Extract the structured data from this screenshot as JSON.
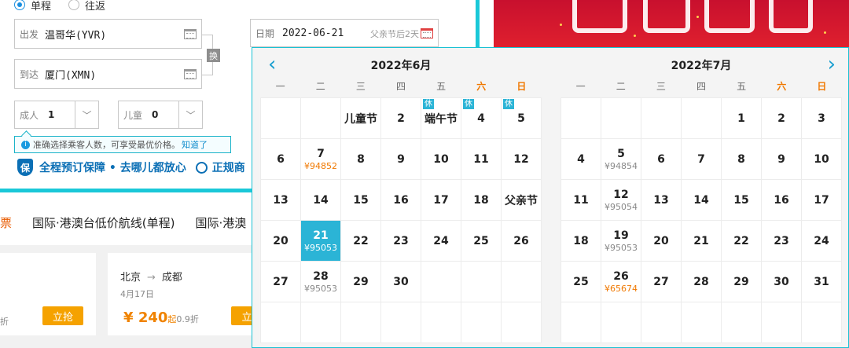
{
  "trip_type": {
    "oneway": "单程",
    "roundtrip": "往返"
  },
  "depart": {
    "label": "出发",
    "value": "温哥华(YVR)"
  },
  "arrive": {
    "label": "到达",
    "value": "厦门(XMN)"
  },
  "swap_label": "换",
  "adult": {
    "label": "成人",
    "value": "1"
  },
  "child": {
    "label": "儿童",
    "value": "0"
  },
  "tip": {
    "text": "准确选择乘客人数，可享受最优价格。",
    "link": "知道了"
  },
  "guarantee": {
    "text": "全程预订保障 • 去哪儿都放心",
    "text2": "正规商"
  },
  "tabs": {
    "first": "票",
    "t1": "国际·港澳台低价航线(单程)",
    "t2": "国际·港澳"
  },
  "card1": {
    "discount": "折",
    "grab": "立抢"
  },
  "card2": {
    "from": "北京",
    "arrow": "→",
    "to": "成都",
    "date": "4月17日",
    "currency": "¥",
    "price": "240",
    "qi": "起",
    "discount": "0.9折",
    "grab": "立"
  },
  "date_field": {
    "label": "日期",
    "value": "2022-06-21",
    "hint": "父亲节后2天"
  },
  "calendar": {
    "prev": "‹",
    "next": "›",
    "weekdays": [
      "一",
      "二",
      "三",
      "四",
      "五",
      "六",
      "日"
    ],
    "months": [
      {
        "title": "2022年6月",
        "offset": 2,
        "days": [
          {
            "d": "儿童节"
          },
          {
            "d": "2"
          },
          {
            "d": "端午节",
            "rest": "休"
          },
          {
            "d": "4",
            "rest": "休"
          },
          {
            "d": "5",
            "rest": "休"
          },
          {
            "d": "6"
          },
          {
            "d": "7",
            "p": "¥94852",
            "low": true
          },
          {
            "d": "8"
          },
          {
            "d": "9"
          },
          {
            "d": "10"
          },
          {
            "d": "11"
          },
          {
            "d": "12"
          },
          {
            "d": "13"
          },
          {
            "d": "14"
          },
          {
            "d": "15"
          },
          {
            "d": "16"
          },
          {
            "d": "17"
          },
          {
            "d": "18"
          },
          {
            "d": "父亲节"
          },
          {
            "d": "20"
          },
          {
            "d": "21",
            "p": "¥95053",
            "sel": true
          },
          {
            "d": "22"
          },
          {
            "d": "23"
          },
          {
            "d": "24"
          },
          {
            "d": "25"
          },
          {
            "d": "26"
          },
          {
            "d": "27"
          },
          {
            "d": "28",
            "p": "¥95053"
          },
          {
            "d": "29"
          },
          {
            "d": "30"
          }
        ]
      },
      {
        "title": "2022年7月",
        "offset": 4,
        "days": [
          {
            "d": "1"
          },
          {
            "d": "2"
          },
          {
            "d": "3"
          },
          {
            "d": "4"
          },
          {
            "d": "5",
            "p": "¥94854"
          },
          {
            "d": "6"
          },
          {
            "d": "7"
          },
          {
            "d": "8"
          },
          {
            "d": "9"
          },
          {
            "d": "10"
          },
          {
            "d": "11"
          },
          {
            "d": "12",
            "p": "¥95054"
          },
          {
            "d": "13"
          },
          {
            "d": "14"
          },
          {
            "d": "15"
          },
          {
            "d": "16"
          },
          {
            "d": "17"
          },
          {
            "d": "18"
          },
          {
            "d": "19",
            "p": "¥95053"
          },
          {
            "d": "20"
          },
          {
            "d": "21"
          },
          {
            "d": "22"
          },
          {
            "d": "23"
          },
          {
            "d": "24"
          },
          {
            "d": "25"
          },
          {
            "d": "26",
            "p": "¥65674",
            "low": true
          },
          {
            "d": "27"
          },
          {
            "d": "28"
          },
          {
            "d": "29"
          },
          {
            "d": "30"
          },
          {
            "d": "31"
          }
        ]
      }
    ]
  },
  "colors": {
    "accent": "#1ac8d8",
    "selected": "#2bb4d6",
    "price_low": "#f07800",
    "link": "#0e8ccc",
    "banner": "#d0182e"
  },
  "icons": {
    "calendar": "calendar-icon",
    "info": "info-icon",
    "shield": "shield-icon",
    "dropdown": "chevron-down-icon"
  }
}
